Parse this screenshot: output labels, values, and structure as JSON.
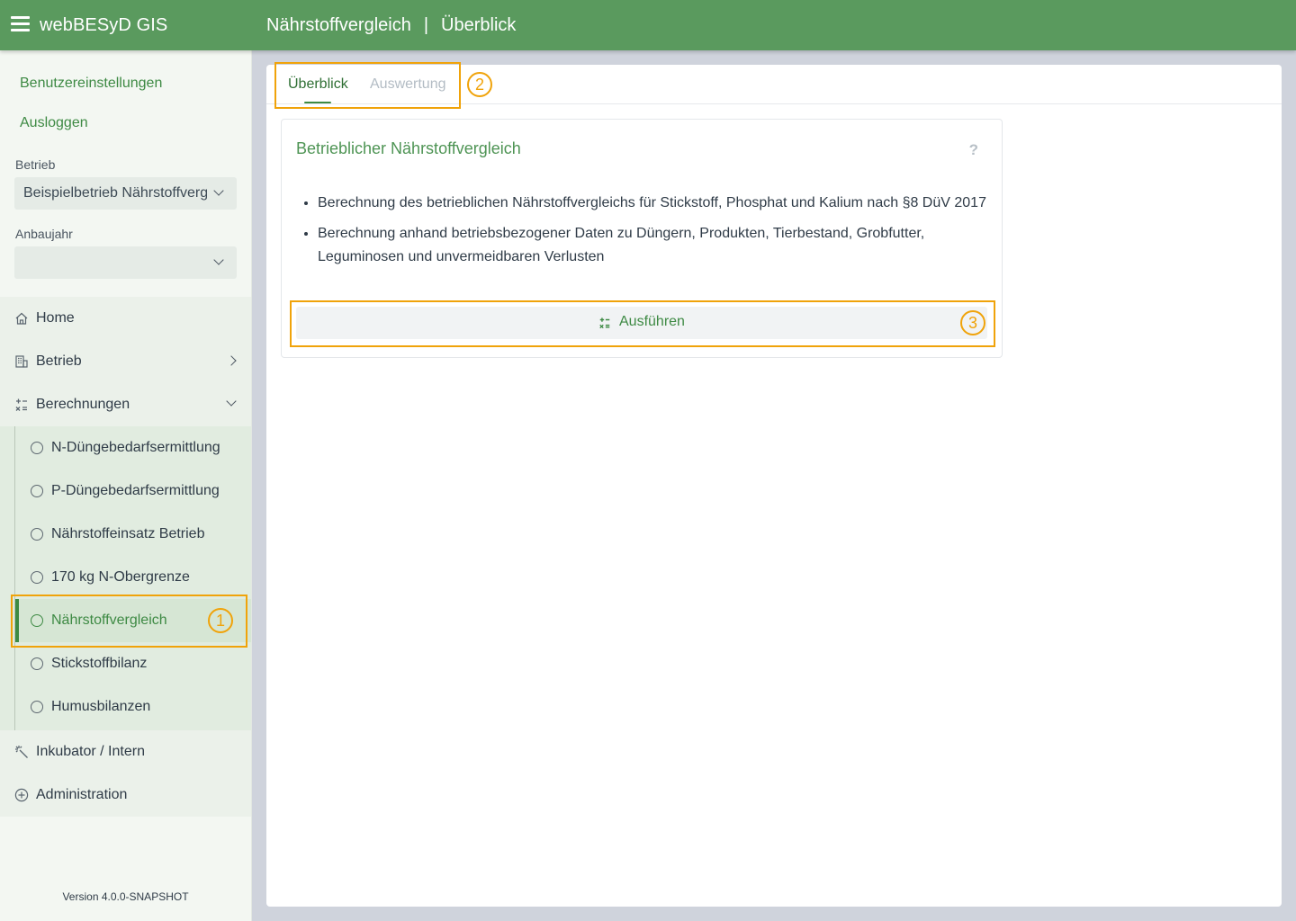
{
  "header": {
    "app_title": "webBESyD GIS",
    "section": "Nährstoffvergleich",
    "separator": "|",
    "subsection": "Überblick"
  },
  "sidebar": {
    "links": [
      "Benutzereinstellungen",
      "Ausloggen"
    ],
    "betrieb": {
      "label": "Betrieb",
      "value": "Beispielbetrieb Nährstoffvergleich"
    },
    "anbaujahr": {
      "label": "Anbaujahr",
      "value": ""
    },
    "nav": {
      "home": "Home",
      "betrieb": "Betrieb",
      "berechnungen": "Berechnungen",
      "sub_items": [
        "N-Düngebedarfsermittlung",
        "P-Düngebedarfsermittlung",
        "Nährstoffeinsatz Betrieb",
        "170 kg N-Obergrenze",
        "Nährstoffvergleich",
        "Stickstoffbilanz",
        "Humusbilanzen"
      ],
      "active_sub_item": "Nährstoffvergleich",
      "inkubator": "Inkubator / Intern",
      "administration": "Administration"
    },
    "version": "Version 4.0.0-SNAPSHOT"
  },
  "tabs": [
    "Überblick",
    "Auswertung"
  ],
  "active_tab": "Überblick",
  "card": {
    "title": "Betrieblicher Nährstoffvergleich",
    "help": "?",
    "bullets": [
      "Berechnung des betrieblichen Nährstoffvergleichs für Stickstoff, Phosphat und Kalium nach §8 DüV 2017",
      "Berechnung anhand betriebsbezogener Daten zu Düngern, Produkten, Tierbestand, Grobfutter, Leguminosen und unvermeidbaren Verlusten"
    ],
    "run_button": "Ausführen"
  },
  "callouts": [
    "1",
    "2",
    "3"
  ],
  "colors": {
    "header_bg": "#5a9a5e",
    "accent": "#3e8a44",
    "callout": "#f0a30a"
  }
}
